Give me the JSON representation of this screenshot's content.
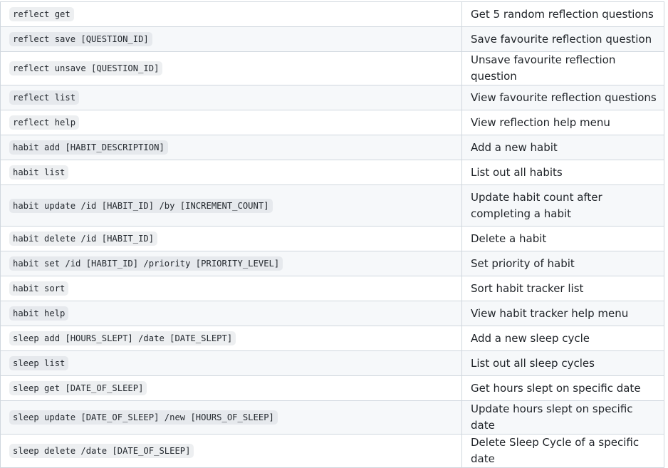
{
  "commands": [
    {
      "command": "reflect get",
      "description": "Get 5 random reflection questions"
    },
    {
      "command": "reflect save [QUESTION_ID]",
      "description": "Save favourite reflection question"
    },
    {
      "command": "reflect unsave [QUESTION_ID]",
      "description": "Unsave favourite reflection question"
    },
    {
      "command": "reflect list",
      "description": "View favourite reflection questions"
    },
    {
      "command": "reflect help",
      "description": "View reflection help menu"
    },
    {
      "command": "habit add [HABIT_DESCRIPTION]",
      "description": "Add a new habit"
    },
    {
      "command": "habit list",
      "description": "List out all habits"
    },
    {
      "command": "habit update /id [HABIT_ID] /by [INCREMENT_COUNT]",
      "description": "Update habit count after completing a habit"
    },
    {
      "command": "habit delete /id [HABIT_ID]",
      "description": "Delete a habit"
    },
    {
      "command": "habit set /id [HABIT_ID] /priority [PRIORITY_LEVEL]",
      "description": "Set priority of habit"
    },
    {
      "command": "habit sort",
      "description": "Sort habit tracker list"
    },
    {
      "command": "habit help",
      "description": "View habit tracker help menu"
    },
    {
      "command": "sleep add [HOURS_SLEPT] /date [DATE_SLEPT]",
      "description": "Add a new sleep cycle"
    },
    {
      "command": "sleep list",
      "description": "List out all sleep cycles"
    },
    {
      "command": "sleep get [DATE_OF_SLEEP]",
      "description": "Get hours slept on specific date"
    },
    {
      "command": "sleep update [DATE_OF_SLEEP] /new [HOURS_OF_SLEEP]",
      "description": "Update hours slept on specific date"
    },
    {
      "command": "sleep delete /date [DATE_OF_SLEEP]",
      "description": "Delete Sleep Cycle of a specific date"
    }
  ]
}
